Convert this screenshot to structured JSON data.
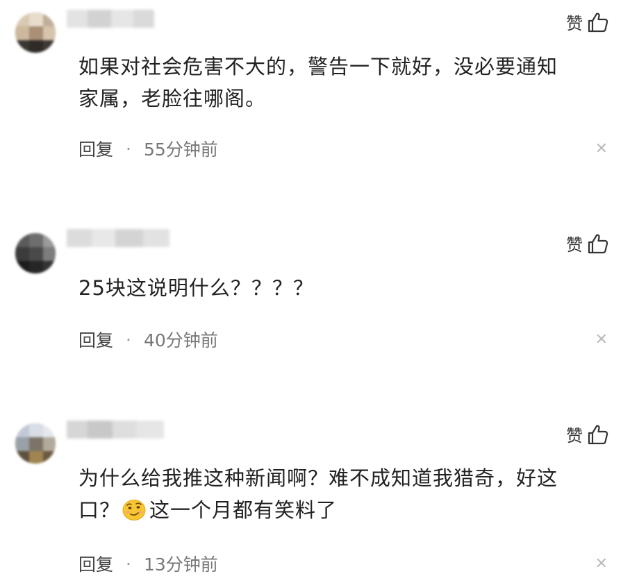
{
  "like_label": "赞",
  "reply_label": "回复",
  "separator": "·",
  "comments": [
    {
      "text_lines": [
        "如果对社会危害不大的，警告一下就好，没必要通知",
        "家属，老脸往哪阁。"
      ],
      "time": "55分钟前"
    },
    {
      "text_lines": [
        "25块这说明什么？？？？"
      ],
      "time": "40分钟前"
    },
    {
      "text_lines": [
        "为什么给我推这种新闻啊？难不成知道我猎奇，好这"
      ],
      "text_line2_prefix": "口？",
      "emoji": "smirk-emoji",
      "text_line2_suffix": "这一个月都有笑料了",
      "time": "13分钟前"
    }
  ]
}
